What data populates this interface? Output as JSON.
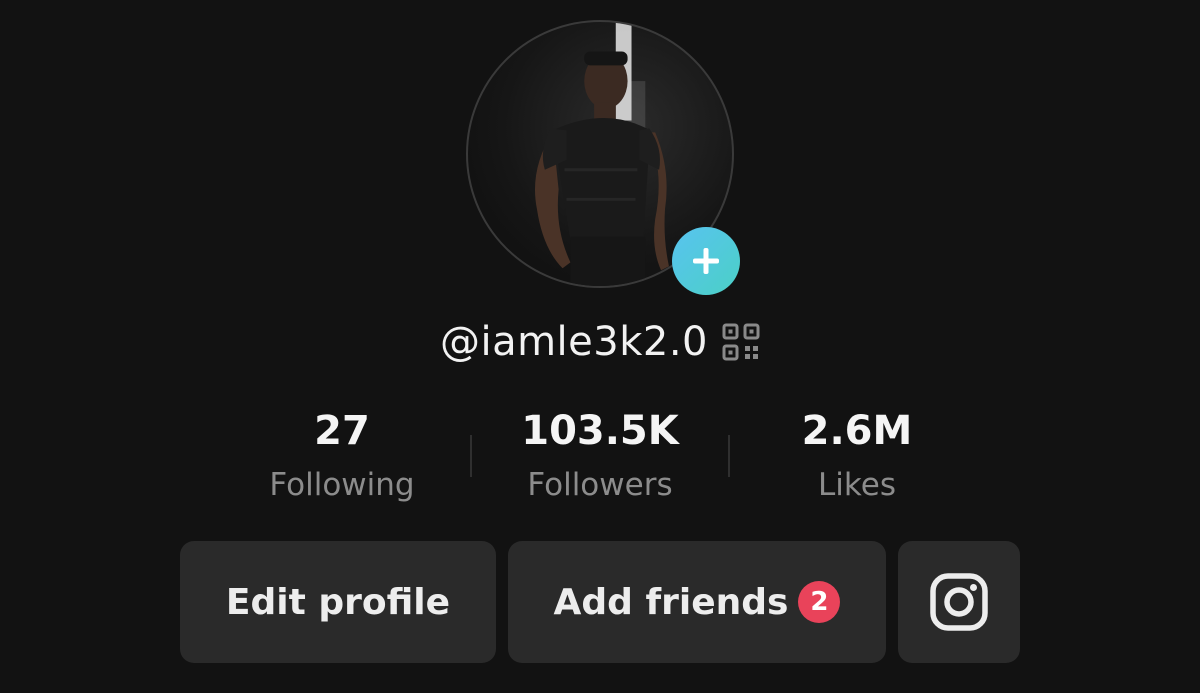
{
  "profile": {
    "username": "@iamle3k2.0"
  },
  "stats": [
    {
      "value": "27",
      "label": "Following"
    },
    {
      "value": "103.5K",
      "label": "Followers"
    },
    {
      "value": "2.6M",
      "label": "Likes"
    }
  ],
  "actions": {
    "edit_profile_label": "Edit profile",
    "add_friends_label": "Add friends",
    "add_friends_badge": "2"
  },
  "icons": {
    "add_avatar": "plus-icon",
    "qr": "qr-code-icon",
    "instagram": "instagram-icon"
  },
  "colors": {
    "background": "#121212",
    "button_bg": "#2a2a2a",
    "badge": "#e9435a",
    "add_avatar_gradient_start": "#58c3f0",
    "add_avatar_gradient_end": "#4bd0c6",
    "label_gray": "#8c8c8c"
  }
}
